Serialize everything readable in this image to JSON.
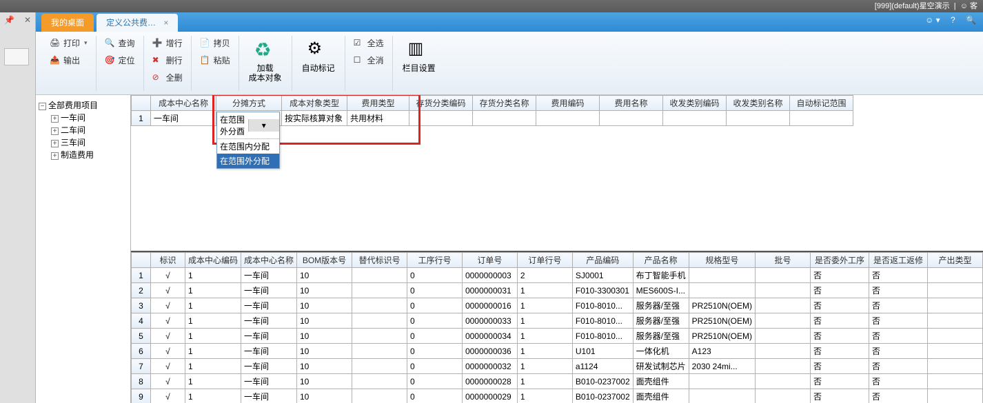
{
  "titlebar": {
    "session": "[999](default)星空演示",
    "guest": "客"
  },
  "tabs": {
    "home": "我的桌面",
    "active": "定义公共费…"
  },
  "toolbar": {
    "print": "打印",
    "output": "输出",
    "search": "查询",
    "locate": "定位",
    "addRow": "增行",
    "delRow": "删行",
    "delAll": "全删",
    "copy": "拷贝",
    "paste": "粘贴",
    "loadObj1": "加载",
    "loadObj2": "成本对象",
    "autoMark": "自动标记",
    "selectAll": "全选",
    "deselectAll": "全消",
    "colSetting": "栏目设置"
  },
  "tree": {
    "root": "全部费用项目",
    "children": [
      "一车间",
      "二车间",
      "三车间",
      "制造费用"
    ]
  },
  "topGrid": {
    "headers": [
      "成本中心名称",
      "分摊方式",
      "成本对象类型",
      "费用类型",
      "存货分类编码",
      "存货分类名称",
      "费用编码",
      "费用名称",
      "收发类别编码",
      "收发类别名称",
      "自动标记范围"
    ],
    "row": {
      "num": "1",
      "center": "一车间",
      "alloc": "在范围外分酉",
      "objType": "按实际核算对象",
      "costType": "共用材料"
    }
  },
  "dropdown": {
    "current": "在范围外分酉",
    "opt1": "在范围内分配",
    "opt2": "在范围外分配"
  },
  "bottomGrid": {
    "headers": [
      "标识",
      "成本中心编码",
      "成本中心名称",
      "BOM版本号",
      "替代标识号",
      "工序行号",
      "订单号",
      "订单行号",
      "产品编码",
      "产品名称",
      "规格型号",
      "批号",
      "是否委外工序",
      "是否返工返修",
      "产出类型"
    ],
    "rows": [
      {
        "n": "1",
        "id": "√",
        "code": "1",
        "name": "一车间",
        "bom": "10",
        "alt": "",
        "proc": "0",
        "order": "0000000003",
        "line": "2",
        "pcode": "SJ0001",
        "pname": "布丁智能手机",
        "spec": "",
        "lot": "",
        "out1": "否",
        "out2": "否",
        "out3": ""
      },
      {
        "n": "2",
        "id": "√",
        "code": "1",
        "name": "一车间",
        "bom": "10",
        "alt": "",
        "proc": "0",
        "order": "0000000031",
        "line": "1",
        "pcode": "F010-3300301",
        "pname": "MES600S-I...",
        "spec": "",
        "lot": "",
        "out1": "否",
        "out2": "否",
        "out3": ""
      },
      {
        "n": "3",
        "id": "√",
        "code": "1",
        "name": "一车间",
        "bom": "10",
        "alt": "",
        "proc": "0",
        "order": "0000000016",
        "line": "1",
        "pcode": "F010-8010...",
        "pname": "服务器/至强",
        "spec": "PR2510N(OEM)",
        "lot": "",
        "out1": "否",
        "out2": "否",
        "out3": ""
      },
      {
        "n": "4",
        "id": "√",
        "code": "1",
        "name": "一车间",
        "bom": "10",
        "alt": "",
        "proc": "0",
        "order": "0000000033",
        "line": "1",
        "pcode": "F010-8010...",
        "pname": "服务器/至强",
        "spec": "PR2510N(OEM)",
        "lot": "",
        "out1": "否",
        "out2": "否",
        "out3": ""
      },
      {
        "n": "5",
        "id": "√",
        "code": "1",
        "name": "一车间",
        "bom": "10",
        "alt": "",
        "proc": "0",
        "order": "0000000034",
        "line": "1",
        "pcode": "F010-8010...",
        "pname": "服务器/至强",
        "spec": "PR2510N(OEM)",
        "lot": "",
        "out1": "否",
        "out2": "否",
        "out3": ""
      },
      {
        "n": "6",
        "id": "√",
        "code": "1",
        "name": "一车间",
        "bom": "10",
        "alt": "",
        "proc": "0",
        "order": "0000000036",
        "line": "1",
        "pcode": "U101",
        "pname": "一体化机",
        "spec": "A123",
        "lot": "",
        "out1": "否",
        "out2": "否",
        "out3": ""
      },
      {
        "n": "7",
        "id": "√",
        "code": "1",
        "name": "一车间",
        "bom": "10",
        "alt": "",
        "proc": "0",
        "order": "0000000032",
        "line": "1",
        "pcode": "a1124",
        "pname": "研发试制芯片",
        "spec": "2030 24mi...",
        "lot": "",
        "out1": "否",
        "out2": "否",
        "out3": ""
      },
      {
        "n": "8",
        "id": "√",
        "code": "1",
        "name": "一车间",
        "bom": "10",
        "alt": "",
        "proc": "0",
        "order": "0000000028",
        "line": "1",
        "pcode": "B010-0237002",
        "pname": "面壳组件",
        "spec": "",
        "lot": "",
        "out1": "否",
        "out2": "否",
        "out3": ""
      },
      {
        "n": "9",
        "id": "√",
        "code": "1",
        "name": "一车间",
        "bom": "10",
        "alt": "",
        "proc": "0",
        "order": "0000000029",
        "line": "1",
        "pcode": "B010-0237002",
        "pname": "面壳组件",
        "spec": "",
        "lot": "",
        "out1": "否",
        "out2": "否",
        "out3": ""
      }
    ]
  }
}
